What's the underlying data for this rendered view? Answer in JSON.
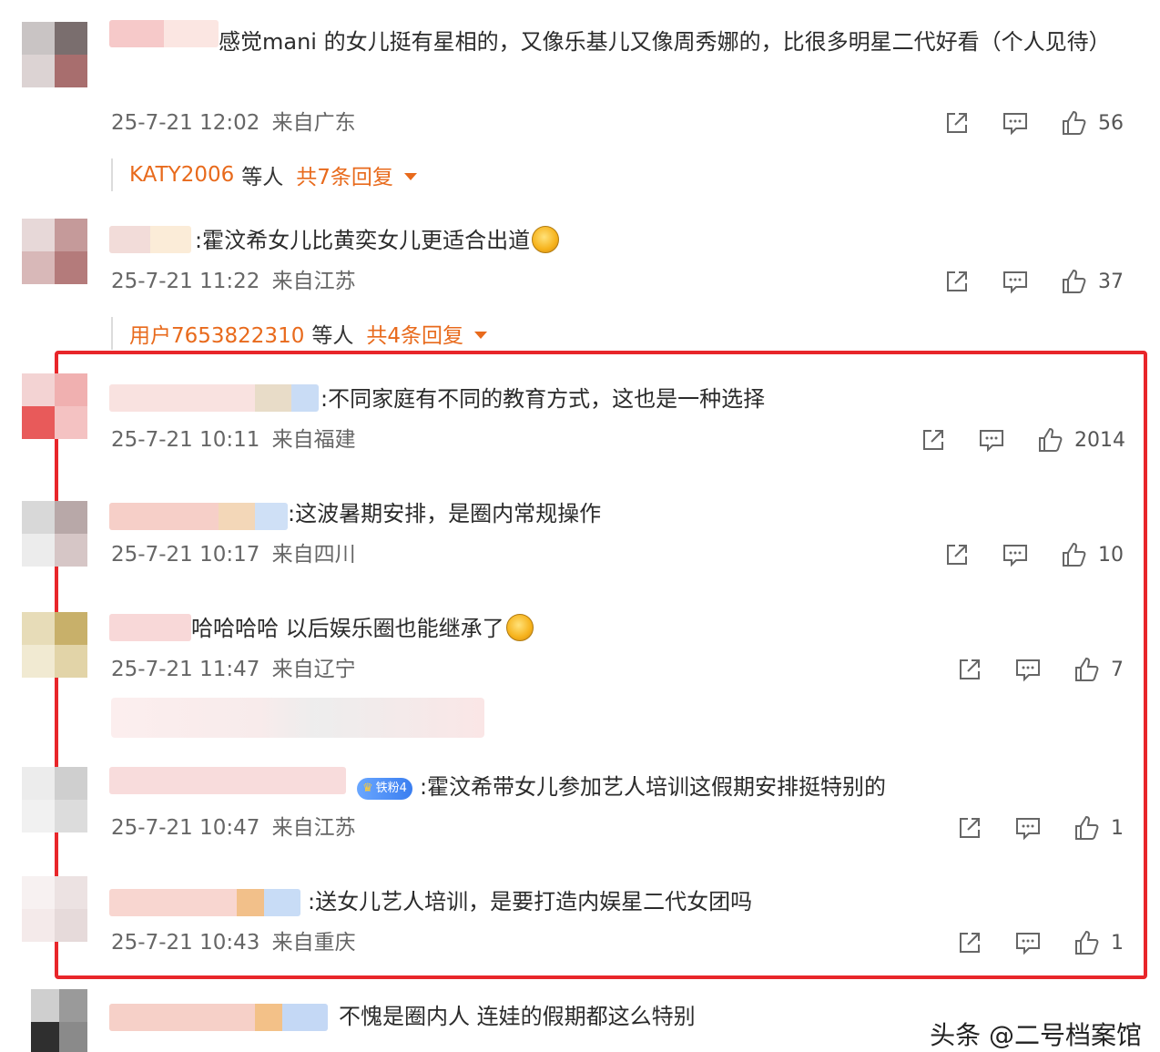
{
  "comments": [
    {
      "text_prefix": "",
      "text": "感觉mani 的女儿挺有星相的，又像乐基儿又像周秀娜的，比很多明星二代好看（个人见待）",
      "time": "25-7-21 12:02",
      "location": "来自广东",
      "likes": "56",
      "replies": {
        "user": "KATY2006",
        "etc": "等人",
        "total": "共7条回复"
      }
    },
    {
      "text": ":霍汶希女儿比黄奕女儿更适合出道",
      "time": "25-7-21 11:22",
      "location": "来自江苏",
      "likes": "37",
      "replies": {
        "user": "用户7653822310",
        "etc": "等人",
        "total": "共4条回复"
      }
    },
    {
      "text": ":不同家庭有不同的教育方式，这也是一种选择",
      "time": "25-7-21 10:11",
      "location": "来自福建",
      "likes": "2014"
    },
    {
      "text": ":这波暑期安排，是圈内常规操作",
      "time": "25-7-21 10:17",
      "location": "来自四川",
      "likes": "10"
    },
    {
      "text": "哈哈哈哈 以后娱乐圈也能继承了",
      "time": "25-7-21 11:47",
      "location": "来自辽宁",
      "likes": "7"
    },
    {
      "text": ":霍汶希带女儿参加艺人培训这假期安排挺特别的",
      "badge": "铁粉4",
      "time": "25-7-21 10:47",
      "location": "来自江苏",
      "likes": "1"
    },
    {
      "text": ":送女儿艺人培训，是要打造内娱星二代女团吗",
      "time": "25-7-21 10:43",
      "location": "来自重庆",
      "likes": "1"
    },
    {
      "text": "不愧是圈内人 连娃的假期都这么特别"
    }
  ],
  "watermark": "头条 @二号档案馆",
  "colors": {
    "accent": "#e86a1c",
    "highlight_border": "#e8262a"
  },
  "icons": {
    "share": "share-icon",
    "comment": "comment-icon",
    "like": "thumbs-up-icon",
    "expand": "caret-down-icon"
  }
}
